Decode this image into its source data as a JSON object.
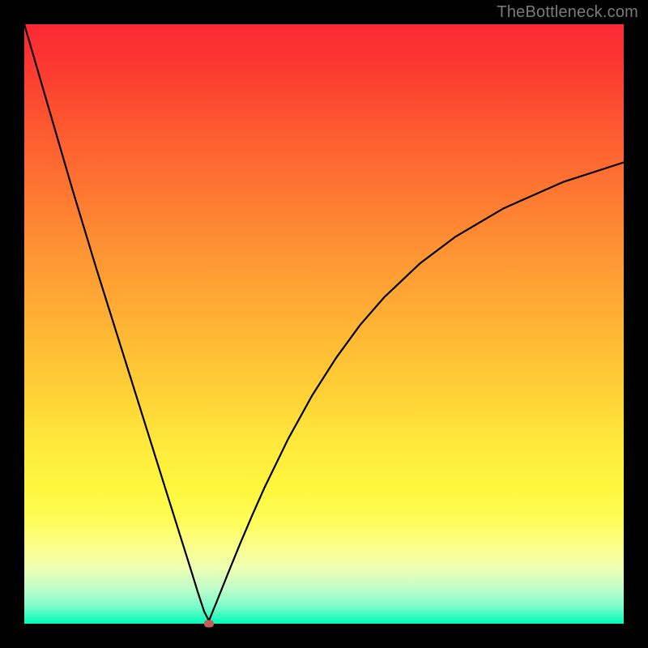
{
  "watermark": "TheBottleneck.com",
  "chart_data": {
    "type": "line",
    "title": "",
    "xlabel": "",
    "ylabel": "",
    "xlim": [
      0,
      100
    ],
    "ylim": [
      0,
      102
    ],
    "grid": false,
    "legend": false,
    "marker": {
      "x": 30.8,
      "y": 0,
      "color": "#c06058"
    },
    "series": [
      {
        "name": "curve",
        "color": "#000000",
        "x": [
          0,
          4,
          8,
          12,
          16,
          20,
          24,
          26,
          28,
          29,
          30,
          30.8,
          32,
          34,
          36,
          38,
          40,
          44,
          48,
          52,
          56,
          60,
          66,
          72,
          80,
          90,
          100
        ],
        "y": [
          102,
          88,
          74,
          60.5,
          47.5,
          34.5,
          21.5,
          15.0,
          8.5,
          5.2,
          2.1,
          0.5,
          3.5,
          8.6,
          13.6,
          18.4,
          23.0,
          31.4,
          38.8,
          45.2,
          50.8,
          55.5,
          61.3,
          65.9,
          70.7,
          75.2,
          78.5
        ]
      }
    ]
  }
}
